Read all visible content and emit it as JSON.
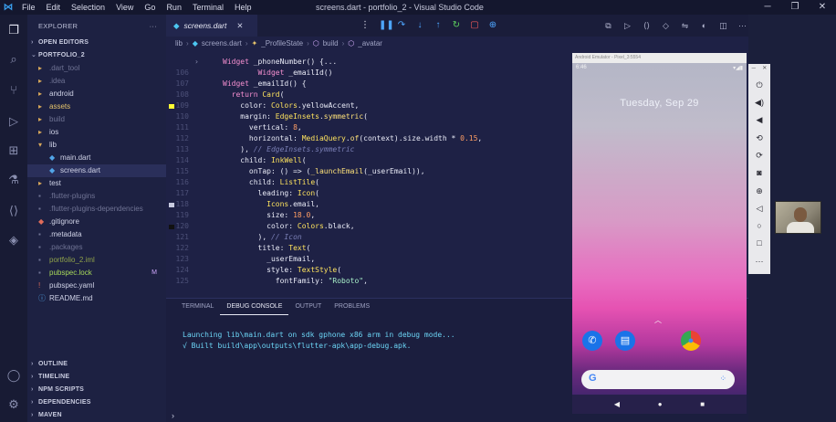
{
  "window": {
    "title": "screens.dart - portfolio_2 - Visual Studio Code",
    "menu": [
      "File",
      "Edit",
      "Selection",
      "View",
      "Go",
      "Run",
      "Terminal",
      "Help"
    ]
  },
  "sidebar": {
    "explorer_label": "EXPLORER",
    "more": "···",
    "open_editors": "OPEN EDITORS",
    "project": "PORTFOLIO_2",
    "tree": [
      {
        "label": ".dart_tool",
        "icon": "folder-icon",
        "depth": 1,
        "color": "gray"
      },
      {
        "label": ".idea",
        "icon": "folder-icon",
        "depth": 1,
        "color": "gray"
      },
      {
        "label": "android",
        "icon": "folder-icon",
        "depth": 1,
        "color": "white"
      },
      {
        "label": "assets",
        "icon": "folder-icon",
        "depth": 1,
        "color": "yellow"
      },
      {
        "label": "build",
        "icon": "folder-icon",
        "depth": 1,
        "color": "gray"
      },
      {
        "label": "ios",
        "icon": "folder-icon",
        "depth": 1,
        "color": "white"
      },
      {
        "label": "lib",
        "icon": "folder-open-icon",
        "depth": 1,
        "color": "white"
      },
      {
        "label": "main.dart",
        "icon": "dart-icon",
        "depth": 2,
        "color": "white"
      },
      {
        "label": "screens.dart",
        "icon": "dart-icon",
        "depth": 2,
        "color": "white",
        "selected": true
      },
      {
        "label": "test",
        "icon": "folder-icon",
        "depth": 1,
        "color": "white"
      },
      {
        "label": ".flutter-plugins",
        "icon": "file-icon",
        "depth": 1,
        "color": "gray"
      },
      {
        "label": ".flutter-plugins-dependencies",
        "icon": "file-icon",
        "depth": 1,
        "color": "gray"
      },
      {
        "label": ".gitignore",
        "icon": "git-icon",
        "depth": 1,
        "color": "white"
      },
      {
        "label": ".metadata",
        "icon": "file-icon",
        "depth": 1,
        "color": "white"
      },
      {
        "label": ".packages",
        "icon": "file-icon",
        "depth": 1,
        "color": "gray"
      },
      {
        "label": "portfolio_2.iml",
        "icon": "file-icon",
        "depth": 1,
        "color": "olive"
      },
      {
        "label": "pubspec.lock",
        "icon": "file-icon",
        "depth": 1,
        "color": "lime",
        "badge": "M"
      },
      {
        "label": "pubspec.yaml",
        "icon": "yaml-icon",
        "depth": 1,
        "color": "white"
      },
      {
        "label": "README.md",
        "icon": "info-icon",
        "depth": 1,
        "color": "white"
      }
    ],
    "bottom_sections": [
      "OUTLINE",
      "TIMELINE",
      "NPM SCRIPTS",
      "DEPENDENCIES",
      "MAVEN"
    ]
  },
  "editor": {
    "tab_label": "screens.dart",
    "breadcrumb": [
      "lib",
      "screens.dart",
      "_ProfileState",
      "build",
      "_avatar"
    ],
    "lines": [
      {
        "n": "",
        "fold": "›",
        "parts": [
          [
            "kw",
            "Widget "
          ],
          [
            "vr",
            "_phoneNumber() {..."
          ]
        ]
      },
      {
        "n": "106",
        "fold": "",
        "parts": [
          [
            "kw",
            "        Widget "
          ],
          [
            "vr",
            "_emailId()"
          ]
        ]
      },
      {
        "n": "107",
        "fold": "",
        "parts": [
          [
            "kw",
            "Widget "
          ],
          [
            "vr",
            "_emailId() {"
          ]
        ]
      },
      {
        "n": "108",
        "fold": "",
        "parts": [
          [
            "kw",
            "  return "
          ],
          [
            "ty",
            "Card"
          ],
          [
            "pn",
            "("
          ]
        ]
      },
      {
        "n": "109",
        "fold": "",
        "gutter": "yellow",
        "parts": [
          [
            "vr",
            "    color: "
          ],
          [
            "ty",
            "Colors"
          ],
          [
            "pn",
            "."
          ],
          [
            "vr",
            "yellowAccent,"
          ]
        ]
      },
      {
        "n": "110",
        "fold": "",
        "parts": [
          [
            "vr",
            "    margin: "
          ],
          [
            "ty",
            "EdgeInsets"
          ],
          [
            "pn",
            "."
          ],
          [
            "fn",
            "symmetric"
          ],
          [
            "pn",
            "("
          ]
        ]
      },
      {
        "n": "111",
        "fold": "",
        "parts": [
          [
            "vr",
            "      vertical: "
          ],
          [
            "num",
            "8"
          ],
          [
            "pn",
            ","
          ]
        ]
      },
      {
        "n": "112",
        "fold": "",
        "parts": [
          [
            "vr",
            "      horizontal: "
          ],
          [
            "ty",
            "MediaQuery"
          ],
          [
            "pn",
            "."
          ],
          [
            "fn",
            "of"
          ],
          [
            "pn",
            "(context).size.width * "
          ],
          [
            "num",
            "0.15"
          ],
          [
            "pn",
            ","
          ]
        ]
      },
      {
        "n": "113",
        "fold": "",
        "parts": [
          [
            "pn",
            "    ), "
          ],
          [
            "cm",
            "// EdgeInsets.symmetric"
          ]
        ]
      },
      {
        "n": "114",
        "fold": "",
        "parts": [
          [
            "vr",
            "    child: "
          ],
          [
            "ty",
            "InkWell"
          ],
          [
            "pn",
            "("
          ]
        ]
      },
      {
        "n": "115",
        "fold": "",
        "parts": [
          [
            "vr",
            "      onTap: () => ("
          ],
          [
            "fn",
            "_launchEmail"
          ],
          [
            "pn",
            "(_userEmail)),"
          ]
        ]
      },
      {
        "n": "116",
        "fold": "",
        "parts": [
          [
            "vr",
            "      child: "
          ],
          [
            "ty",
            "ListTile"
          ],
          [
            "pn",
            "("
          ]
        ]
      },
      {
        "n": "117",
        "fold": "",
        "parts": [
          [
            "vr",
            "        leading: "
          ],
          [
            "ty",
            "Icon"
          ],
          [
            "pn",
            "("
          ]
        ]
      },
      {
        "n": "118",
        "fold": "",
        "gutter": "mail",
        "parts": [
          [
            "ty",
            "          Icons"
          ],
          [
            "pn",
            "."
          ],
          [
            "vr",
            "email,"
          ]
        ]
      },
      {
        "n": "119",
        "fold": "",
        "parts": [
          [
            "vr",
            "          size: "
          ],
          [
            "num",
            "18.0"
          ],
          [
            "pn",
            ","
          ]
        ]
      },
      {
        "n": "120",
        "fold": "",
        "gutter": "black",
        "parts": [
          [
            "vr",
            "          color: "
          ],
          [
            "ty",
            "Colors"
          ],
          [
            "pn",
            "."
          ],
          [
            "vr",
            "black,"
          ]
        ]
      },
      {
        "n": "121",
        "fold": "",
        "parts": [
          [
            "pn",
            "        ), "
          ],
          [
            "cm",
            "// Icon"
          ]
        ]
      },
      {
        "n": "122",
        "fold": "",
        "parts": [
          [
            "vr",
            "        title: "
          ],
          [
            "ty",
            "Text"
          ],
          [
            "pn",
            "("
          ]
        ]
      },
      {
        "n": "123",
        "fold": "",
        "parts": [
          [
            "vr",
            "          _userEmail,"
          ]
        ]
      },
      {
        "n": "124",
        "fold": "",
        "parts": [
          [
            "vr",
            "          style: "
          ],
          [
            "ty",
            "TextStyle"
          ],
          [
            "pn",
            "("
          ]
        ]
      },
      {
        "n": "125",
        "fold": "",
        "parts": [
          [
            "vr",
            "            fontFamily: "
          ],
          [
            "str",
            "\"Roboto\""
          ],
          [
            "pn",
            ","
          ]
        ]
      }
    ]
  },
  "panel": {
    "tabs": [
      "TERMINAL",
      "DEBUG CONSOLE",
      "OUTPUT",
      "PROBLEMS"
    ],
    "active_tab": "DEBUG CONSOLE",
    "output_lines": [
      "Launching lib\\main.dart on sdk gphone x86 arm in debug mode...",
      "√ Built build\\app\\outputs\\flutter-apk\\app-debug.apk."
    ],
    "prompt": "›"
  },
  "emulator": {
    "title": "Android Emulator - Pixel_3:5554",
    "time": "6:46",
    "date": "Tuesday, Sep 29"
  },
  "colors": {
    "editor_bg": "#1e2145",
    "sidebar_bg": "#1d2142",
    "accent": "#3aa0f0"
  }
}
